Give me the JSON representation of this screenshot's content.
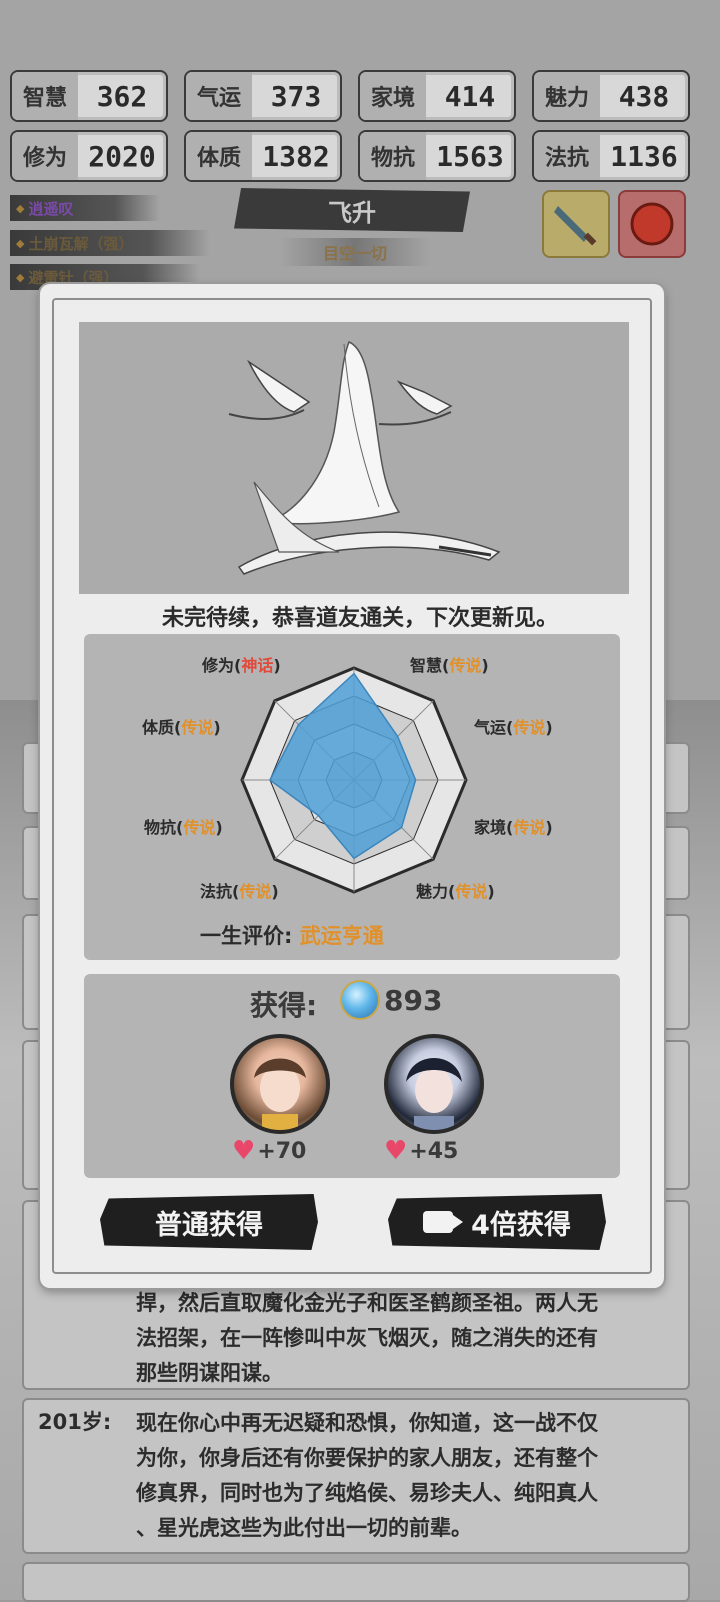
{
  "stats": [
    {
      "name": "智慧",
      "value": "362"
    },
    {
      "name": "气运",
      "value": "373"
    },
    {
      "name": "家境",
      "value": "414"
    },
    {
      "name": "魅力",
      "value": "438"
    },
    {
      "name": "修为",
      "value": "2020"
    },
    {
      "name": "体质",
      "value": "1382"
    },
    {
      "name": "物抗",
      "value": "1563"
    },
    {
      "name": "法抗",
      "value": "1136"
    }
  ],
  "skills": [
    "逍遥叹",
    "土崩瓦解（强）",
    "避雷针（强）"
  ],
  "stage": {
    "title": "飞升",
    "subtitle": "目空一切"
  },
  "modal": {
    "finish_text": "未完待续，恭喜道友通关，下次更新见。",
    "radar": {
      "labels": [
        {
          "name": "修为",
          "grade": "神话"
        },
        {
          "name": "智慧",
          "grade": "传说"
        },
        {
          "name": "气运",
          "grade": "传说"
        },
        {
          "name": "家境",
          "grade": "传说"
        },
        {
          "name": "魅力",
          "grade": "传说"
        },
        {
          "name": "法抗",
          "grade": "传说"
        },
        {
          "name": "物抗",
          "grade": "传说"
        },
        {
          "name": "体质",
          "grade": "传说"
        }
      ],
      "levels": [
        0.95,
        0.55,
        0.55,
        0.6,
        0.7,
        0.45,
        0.75,
        0.7
      ]
    },
    "evaluation_label": "一生评价:",
    "evaluation_value": "武运亨通",
    "gain_label": "获得:",
    "gain_amount": "893",
    "companions": [
      {
        "bonus": "+70"
      },
      {
        "bonus": "+45"
      }
    ],
    "btn_normal": "普通获得",
    "btn_4x": "4倍获得"
  },
  "log": {
    "entry1_lines": [
      "捍，然后直取魔化金光子和医圣鹤颜圣祖。两人无",
      "法招架，在一阵惨叫中灰飞烟灭，随之消失的还有",
      "那些阴谋阳谋。"
    ],
    "entry2_age": "201岁:",
    "entry2_lines": [
      "现在你心中再无迟疑和恐惧，你知道，这一战不仅",
      "为你，你身后还有你要保护的家人朋友，还有整个",
      "修真界，同时也为了纯焰侯、易珍夫人、纯阳真人",
      "、星光虎这些为此付出一切的前辈。"
    ]
  }
}
